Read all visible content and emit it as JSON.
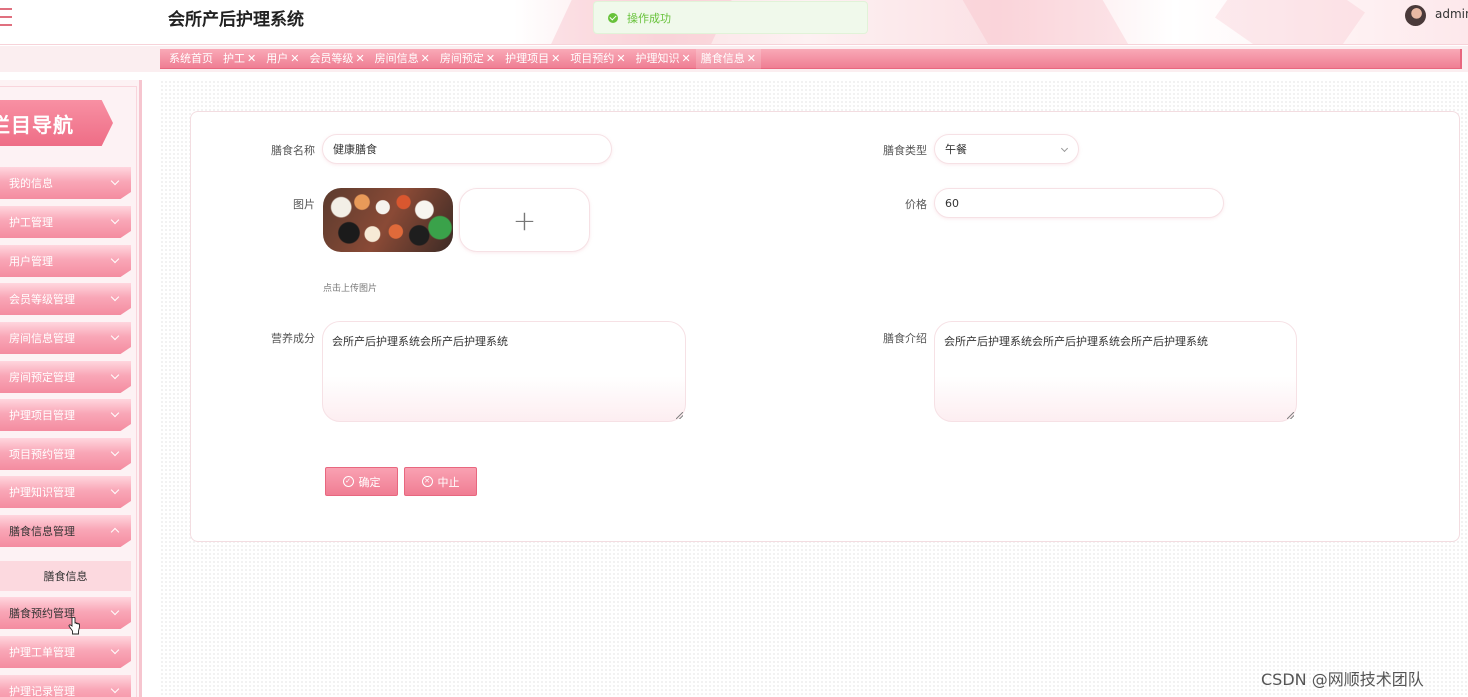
{
  "header": {
    "title": "会所产后护理系统",
    "toast": "操作成功",
    "username": "admin"
  },
  "tabs": [
    {
      "label": "系统首页",
      "closable": false
    },
    {
      "label": "护工",
      "closable": true
    },
    {
      "label": "用户",
      "closable": true
    },
    {
      "label": "会员等级",
      "closable": true
    },
    {
      "label": "房间信息",
      "closable": true
    },
    {
      "label": "房间预定",
      "closable": true
    },
    {
      "label": "护理项目",
      "closable": true
    },
    {
      "label": "项目预约",
      "closable": true
    },
    {
      "label": "护理知识",
      "closable": true
    },
    {
      "label": "膳食信息",
      "closable": true,
      "active": true
    }
  ],
  "tab_close": "✕",
  "sidebar": {
    "title": "栏目导航",
    "items": [
      {
        "label": "我的信息"
      },
      {
        "label": "护工管理"
      },
      {
        "label": "用户管理"
      },
      {
        "label": "会员等级管理"
      },
      {
        "label": "房间信息管理"
      },
      {
        "label": "房间预定管理"
      },
      {
        "label": "护理项目管理"
      },
      {
        "label": "项目预约管理"
      },
      {
        "label": "护理知识管理"
      },
      {
        "label": "膳食信息管理",
        "open": true
      },
      {
        "label": "膳食预约管理"
      },
      {
        "label": "护理工单管理"
      },
      {
        "label": "护理记录管理"
      }
    ],
    "sub_item": "膳食信息"
  },
  "form": {
    "name_label": "膳食名称",
    "name_value": "健康膳食",
    "type_label": "膳食类型",
    "type_value": "午餐",
    "image_label": "图片",
    "upload_plus": "+",
    "upload_hint": "点击上传图片",
    "price_label": "价格",
    "price_value": "60",
    "nutrition_label": "营养成分",
    "nutrition_value": "会所产后护理系统会所产后护理系统",
    "intro_label": "膳食介绍",
    "intro_value": "会所产后护理系统会所产后护理系统会所产后护理系统"
  },
  "buttons": {
    "confirm": "确定",
    "cancel": "中止"
  },
  "watermark": "CSDN @网顺技术团队",
  "colors": {
    "accent": "#f07d93",
    "success": "#67c23a"
  }
}
